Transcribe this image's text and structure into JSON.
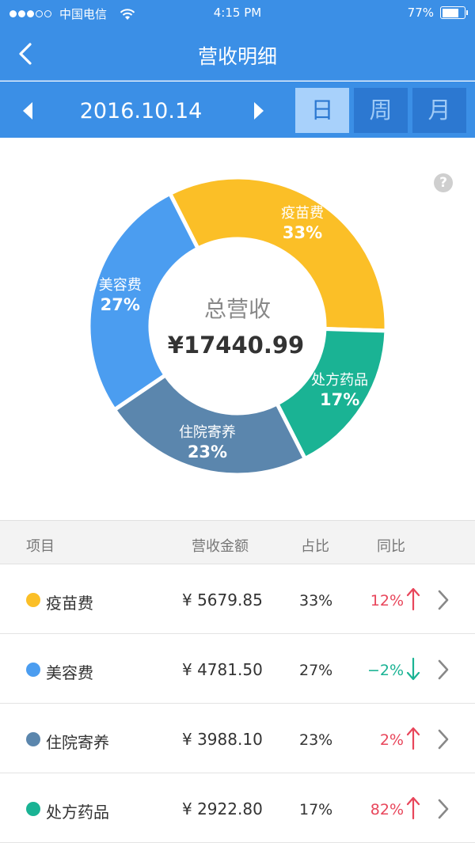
{
  "status_bar": {
    "carrier": "中国电信",
    "time": "4:15 PM",
    "battery_percent": "77%",
    "battery_level": 0.77
  },
  "nav": {
    "title": "营收明细"
  },
  "date_bar": {
    "date": "2016.10.14",
    "tabs": [
      {
        "label": "日",
        "active": true
      },
      {
        "label": "周",
        "active": false
      },
      {
        "label": "月",
        "active": false
      }
    ]
  },
  "help": {
    "label": "?"
  },
  "chart_data": {
    "type": "pie",
    "center_title": "总营收",
    "center_value": "¥17440.99",
    "slices": [
      {
        "name": "疫苗费",
        "value": 33,
        "label": "33%",
        "color": "#fbbf27"
      },
      {
        "name": "处方药品",
        "value": 17,
        "label": "17%",
        "color": "#1ab394"
      },
      {
        "name": "住院寄养",
        "value": 23,
        "label": "23%",
        "color": "#5b86ad"
      },
      {
        "name": "美容费",
        "value": 27,
        "label": "27%",
        "color": "#4b9df0"
      }
    ]
  },
  "table": {
    "headers": {
      "item": "项目",
      "amount": "营收金额",
      "ratio": "占比",
      "yoy": "同比"
    },
    "rows": [
      {
        "name": "疫苗费",
        "amount": "¥ 5679.85",
        "ratio": "33%",
        "yoy": "12%",
        "trend": "up",
        "color": "#fbbf27"
      },
      {
        "name": "美容费",
        "amount": "¥ 4781.50",
        "ratio": "27%",
        "yoy": "−2%",
        "trend": "down",
        "color": "#4b9df0"
      },
      {
        "name": "住院寄养",
        "amount": "¥ 3988.10",
        "ratio": "23%",
        "yoy": "2%",
        "trend": "up",
        "color": "#5b86ad"
      },
      {
        "name": "处方药品",
        "amount": "¥ 2922.80",
        "ratio": "17%",
        "yoy": "82%",
        "trend": "up",
        "color": "#1ab394"
      }
    ]
  },
  "colors": {
    "brand_blue": "#3b8fe6",
    "up_red": "#e8465b",
    "down_green": "#1ab394"
  }
}
